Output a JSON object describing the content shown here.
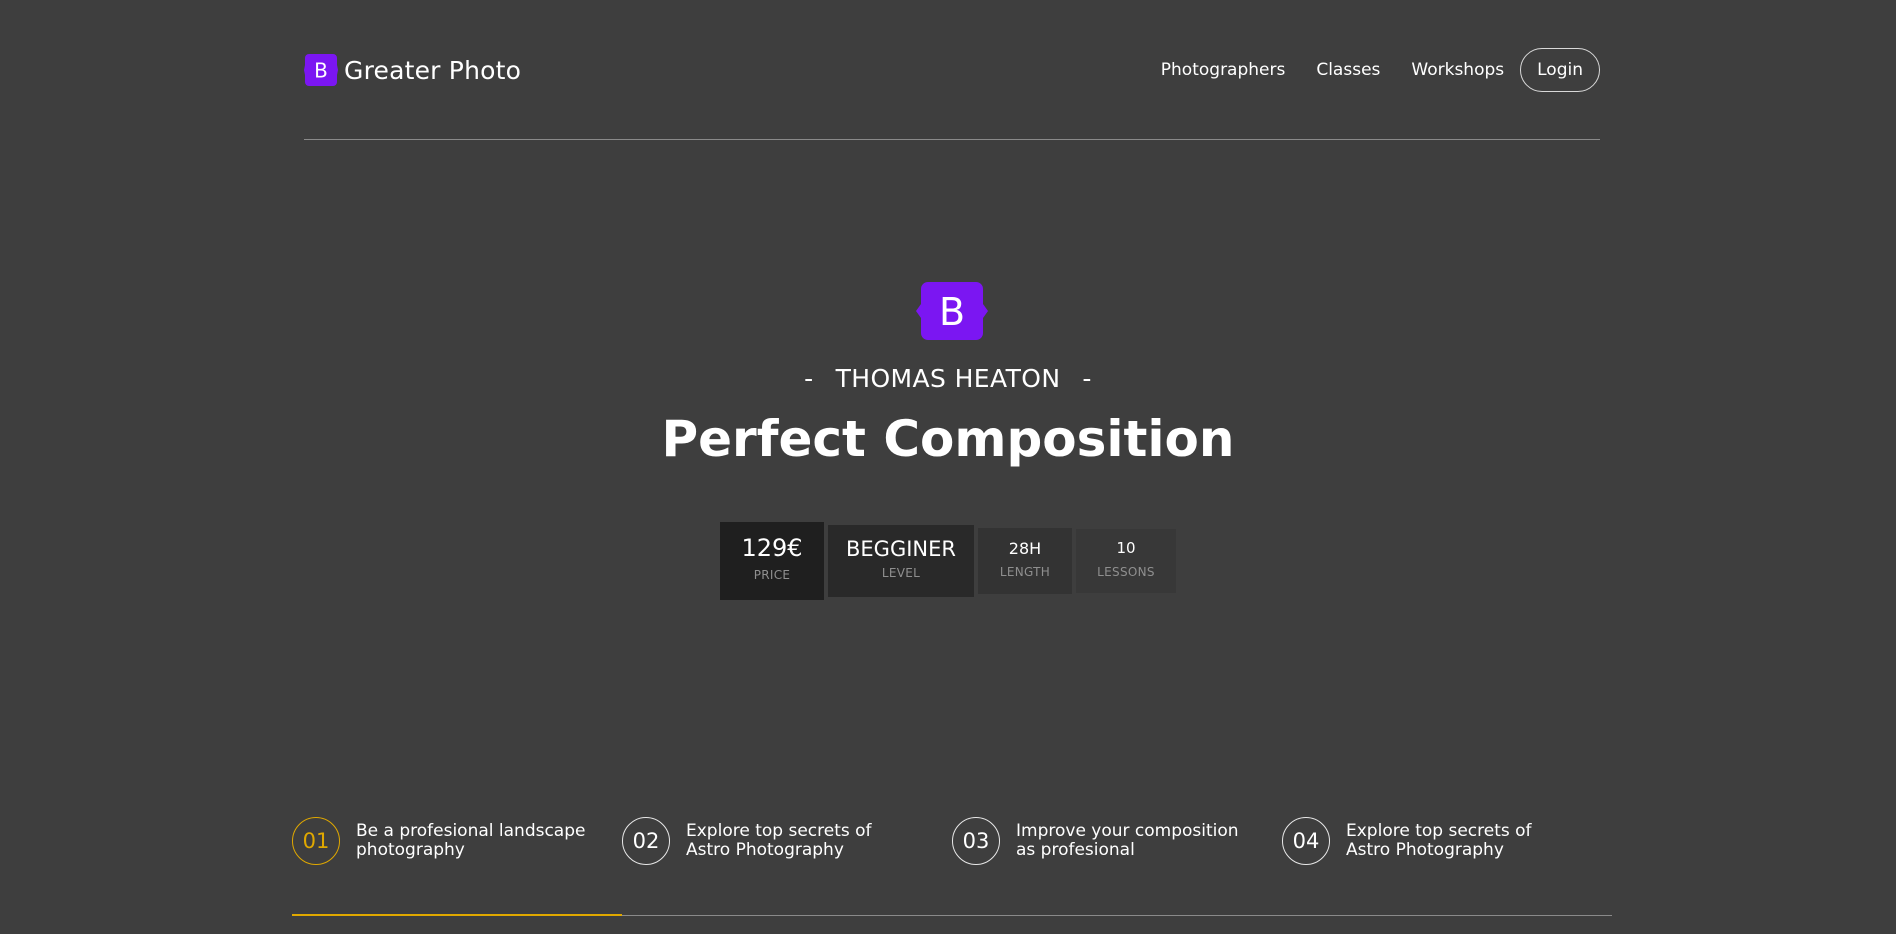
{
  "header": {
    "brand_name": "Greater Photo",
    "logo_letter": "B",
    "nav": [
      "Photographers",
      "Classes",
      "Workshops"
    ],
    "login_label": "Login"
  },
  "hero": {
    "logo_letter": "B",
    "dash_left": "-",
    "author": "THOMAS HEATON",
    "dash_right": "-",
    "title": "Perfect Composition",
    "stats": {
      "price": {
        "value": "129€",
        "label": "PRICE"
      },
      "level": {
        "value": "BEGGINER",
        "label": "LEVEL"
      },
      "length": {
        "value": "28H",
        "label": "LENGTH"
      },
      "lessons": {
        "value": "10",
        "label": "LESSONS"
      }
    }
  },
  "steps": [
    {
      "number": "01",
      "text": "Be a profesional landscape photography"
    },
    {
      "number": "02",
      "text": "Explore top secrets of Astro Photography"
    },
    {
      "number": "03",
      "text": "Improve your composition as profesional"
    },
    {
      "number": "04",
      "text": "Explore top secrets of Astro Photography"
    }
  ],
  "progress": {
    "active_step": 1,
    "fraction": 0.25
  },
  "colors": {
    "background": "#3e3e3e",
    "brand_purple": "#7b16f2",
    "accent": "#e0a800"
  }
}
